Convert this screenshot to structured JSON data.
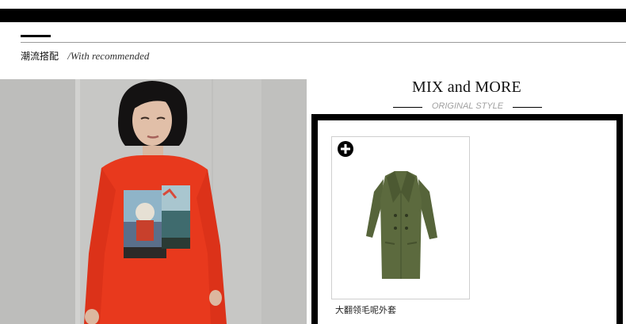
{
  "section": {
    "title_cn": "潮流搭配",
    "title_en": "/With recommended"
  },
  "mix": {
    "title": "MIX and MORE",
    "subtitle": "ORIGINAL STYLE"
  },
  "product": {
    "name": "大翻领毛呢外套",
    "action_icon": "plus-circle-icon",
    "image_icon": "coat-image"
  },
  "colors": {
    "accent": "#000000",
    "dress": "#e8391d",
    "coat": "#5c6a3e",
    "backdrop": "#c7c7c5"
  }
}
